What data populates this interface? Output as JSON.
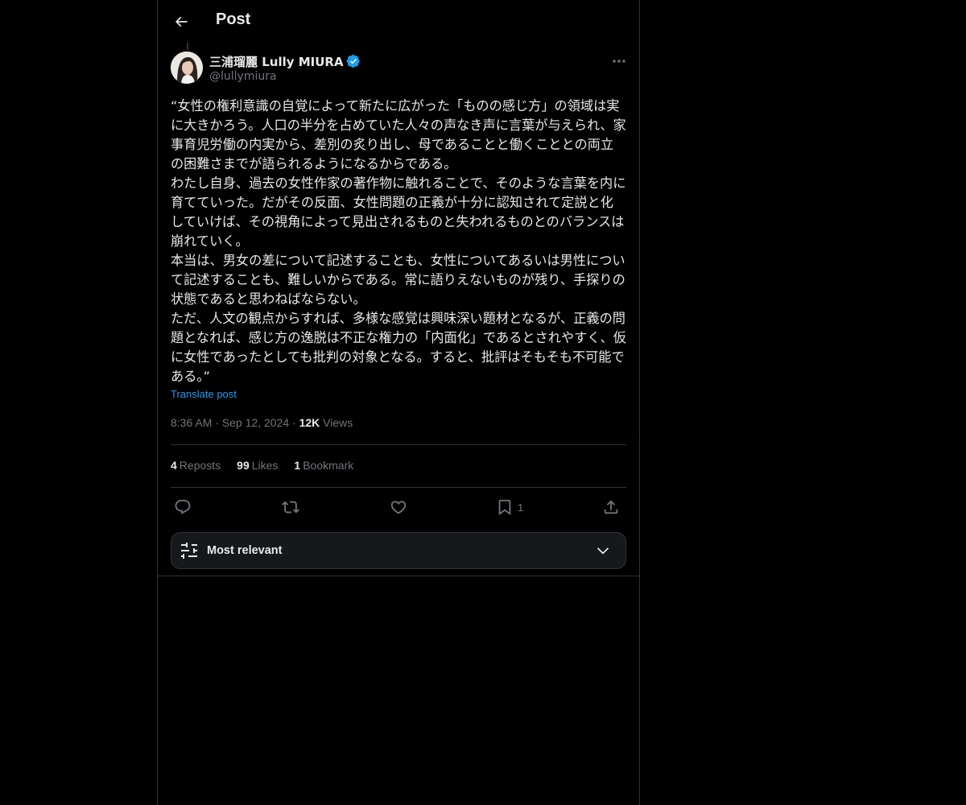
{
  "header": {
    "title": "Post"
  },
  "author": {
    "name": "三浦瑠麗 Lully MIURA",
    "handle": "@lullymiura"
  },
  "post": {
    "paragraphs": [
      "“女性の権利意識の自覚によって新たに広がった「ものの感じ方」の領域は実に大きかろう。人口の半分を占めていた人々の声なき声に言葉が与えられ、家事育児労働の内実から、差別の炙り出し、母であることと働くこととの両立の困難さまでが語られるようになるからである。",
      "わたし自身、過去の女性作家の著作物に触れることで、そのような言葉を内に育てていった。だがその反面、女性問題の正義が十分に認知されて定説と化していけば、その視角によって見出されるものと失われるものとのバランスは崩れていく。",
      "本当は、男女の差について記述することも、女性についてあるいは男性について記述することも、難しいからである。常に語りえないものが残り、手探りの状態であると思わねばならない。",
      "ただ、人文の観点からすれば、多様な感覚は興味深い題材となるが、正義の問題となれば、感じ方の逸脱は不正な権力の「内面化」であるとされやすく、仮に女性であったとしても批判の対象となる。すると、批評はそもそも不可能である。”"
    ],
    "translate_label": "Translate post",
    "time": "8:36 AM",
    "date": "Sep 12, 2024",
    "views_count": "12K",
    "views_label": "Views",
    "separator": "·"
  },
  "stats": {
    "reposts_count": "4",
    "reposts_label": "Reposts",
    "likes_count": "99",
    "likes_label": "Likes",
    "bookmarks_count": "1",
    "bookmarks_label": "Bookmark"
  },
  "actions": {
    "bookmark_count": "1"
  },
  "sort": {
    "label": "Most relevant"
  },
  "colors": {
    "background": "#000000",
    "text": "#e7e9ea",
    "muted": "#71767b",
    "accent": "#1d9bf0",
    "border": "#2f3336"
  },
  "icons": [
    "back-arrow-icon",
    "verified-badge-icon",
    "more-icon",
    "reply-icon",
    "repost-icon",
    "like-icon",
    "bookmark-icon",
    "share-icon",
    "sort-sliders-icon",
    "chevron-down-icon"
  ]
}
